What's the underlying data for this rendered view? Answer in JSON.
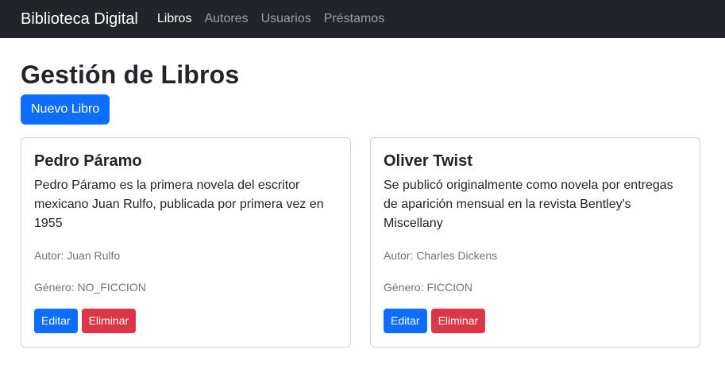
{
  "navbar": {
    "brand": "Biblioteca Digital",
    "links": [
      "Libros",
      "Autores",
      "Usuarios",
      "Préstamos"
    ]
  },
  "page": {
    "title": "Gestión de Libros",
    "new_button": "Nuevo Libro"
  },
  "books": [
    {
      "title": "Pedro Páramo",
      "description": "Pedro Páramo es la primera novela del escritor mexicano Juan Rulfo, publicada por primera vez en 1955",
      "author": "Autor: Juan Rulfo",
      "genre": "Género: NO_FICCION",
      "edit": "Editar",
      "delete": "Eliminar"
    },
    {
      "title": "Oliver Twist",
      "description": "Se publicó originalmente como novela por entregas de aparición mensual en la revista Bentley's Miscellany",
      "author": "Autor: Charles Dickens",
      "genre": "Género: FICCION",
      "edit": "Editar",
      "delete": "Eliminar"
    }
  ],
  "colors": {
    "navbar_bg": "#212529",
    "primary": "#0d6efd",
    "danger": "#dc3545"
  }
}
